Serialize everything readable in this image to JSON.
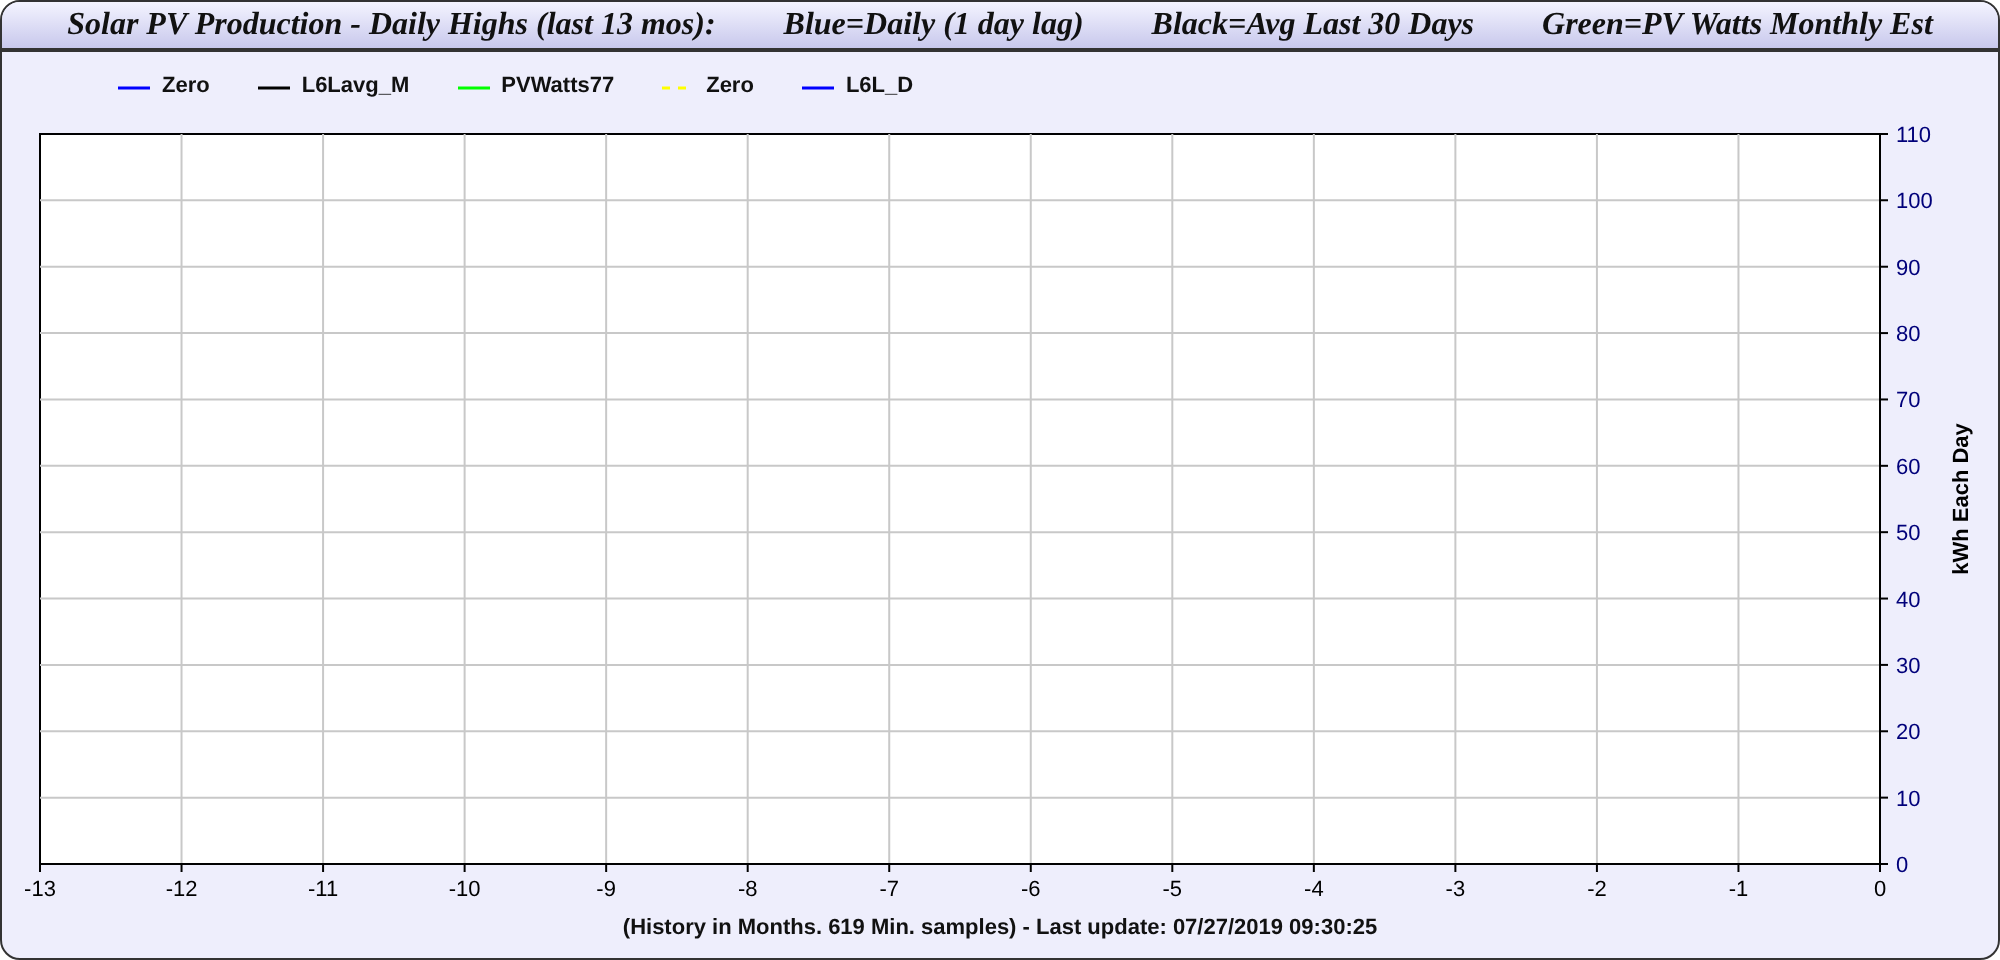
{
  "title_parts": [
    "Solar PV Production - Daily Highs (last 13 mos):",
    "Blue=Daily (1 day lag)",
    "Black=Avg Last 30 Days",
    "Green=PV Watts Monthly Est"
  ],
  "legend": [
    {
      "name": "Zero",
      "color": "#0000ff",
      "kind": "solid"
    },
    {
      "name": "L6Lavg_M",
      "color": "#000000",
      "kind": "solid"
    },
    {
      "name": "PVWatts77",
      "color": "#00ff00",
      "kind": "solid"
    },
    {
      "name": "Zero",
      "color": "#ffff00",
      "kind": "dashed"
    },
    {
      "name": "L6L_D",
      "color": "#0000ff",
      "kind": "solid"
    }
  ],
  "chart_data": {
    "type": "line",
    "grid": true,
    "ylabel": "kWh Each Day",
    "xlim": [
      -13,
      0
    ],
    "ylim": [
      0,
      110
    ],
    "xticks": [
      -13,
      -12,
      -11,
      -10,
      -9,
      -8,
      -7,
      -6,
      -5,
      -4,
      -3,
      -2,
      -1,
      0
    ],
    "yticks": [
      0,
      10,
      20,
      30,
      40,
      50,
      60,
      70,
      80,
      90,
      100,
      110
    ]
  },
  "footer": "(History in Months. 619 Min. samples) - Last update: 07/27/2019 09:30:25"
}
